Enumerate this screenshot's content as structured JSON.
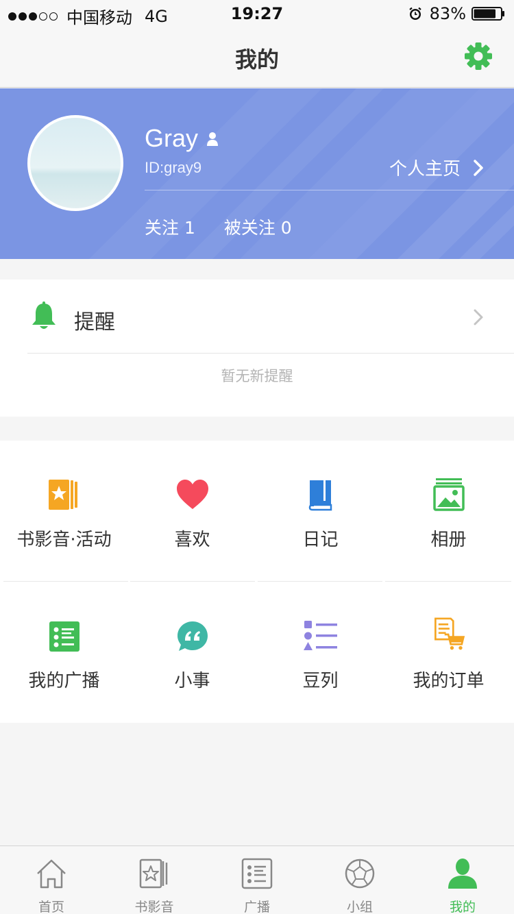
{
  "status_bar": {
    "signal_dots": [
      true,
      true,
      true,
      false,
      false
    ],
    "carrier": "中国移动",
    "network": "4G",
    "time": "19:27",
    "battery_percent": "83%",
    "battery_level": 0.83
  },
  "nav": {
    "title": "我的",
    "settings_icon": "gear-icon"
  },
  "profile": {
    "name": "Gray",
    "id_text": "ID:gray9",
    "homepage_label": "个人主页",
    "following": "关注 1",
    "followers": "被关注 0"
  },
  "reminder": {
    "label": "提醒",
    "empty_text": "暂无新提醒"
  },
  "menu": {
    "items": [
      {
        "label": "书影音·活动",
        "icon": "book-movie-music-icon"
      },
      {
        "label": "喜欢",
        "icon": "heart-icon"
      },
      {
        "label": "日记",
        "icon": "diary-icon"
      },
      {
        "label": "相册",
        "icon": "album-icon"
      },
      {
        "label": "我的广播",
        "icon": "broadcast-icon"
      },
      {
        "label": "小事",
        "icon": "quote-bubble-icon"
      },
      {
        "label": "豆列",
        "icon": "doulist-icon"
      },
      {
        "label": "我的订单",
        "icon": "order-cart-icon"
      }
    ]
  },
  "tabs": [
    {
      "label": "首页",
      "icon": "home-icon",
      "active": false
    },
    {
      "label": "书影音",
      "icon": "cards-star-icon",
      "active": false
    },
    {
      "label": "广播",
      "icon": "broadcast-list-icon",
      "active": false
    },
    {
      "label": "小组",
      "icon": "group-ball-icon",
      "active": false
    },
    {
      "label": "我的",
      "icon": "profile-person-icon",
      "active": true
    }
  ],
  "colors": {
    "accent_green": "#42bd56",
    "header_blue": "#7b95e3"
  }
}
